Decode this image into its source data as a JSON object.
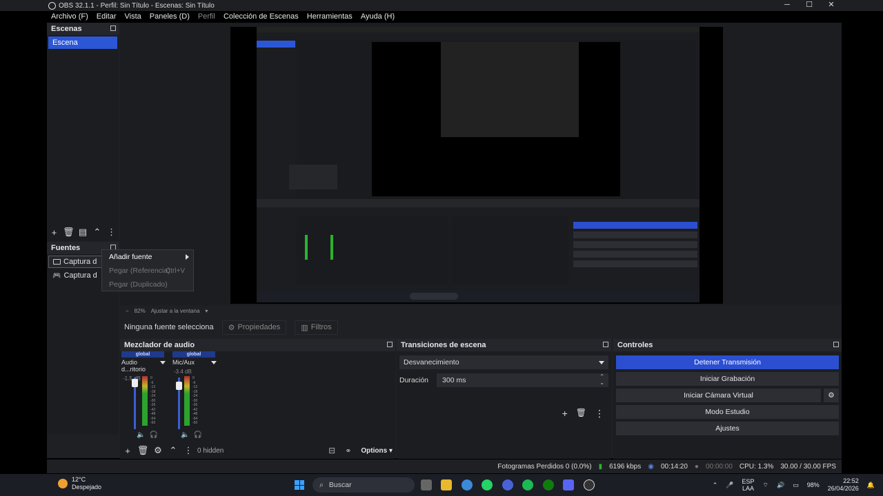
{
  "window": {
    "title": "OBS 32.1.1 - Perfil: Sin Título - Escenas: Sin Título",
    "minimize": "─",
    "maximize": "☐",
    "close": "✕"
  },
  "menu": {
    "items": [
      "Archivo (F)",
      "Editar",
      "Vista",
      "Paneles (D)",
      "Perfil",
      "Colección de Escenas",
      "Herramientas",
      "Ayuda (H)"
    ]
  },
  "scenes": {
    "title": "Escenas",
    "items": [
      "Escena"
    ]
  },
  "sources": {
    "title": "Fuentes",
    "items": [
      {
        "label": "Captura d",
        "icon": "monitor-icon"
      },
      {
        "label": "Captura d",
        "icon": "gamepad-icon"
      }
    ]
  },
  "context_menu": {
    "add_source": "Añadir fuente",
    "paste_ref": "Pegar (Referencia)",
    "paste_ref_shortcut": "Ctrl+V",
    "paste_dup": "Pegar (Duplicado)"
  },
  "zoom": {
    "minus": "−",
    "value": "82%",
    "fit": "Ajustar a la ventana"
  },
  "context_bar": {
    "no_source": "Ninguna fuente selecciona",
    "properties": "Propiedades",
    "filters": "Filtros"
  },
  "mixer": {
    "title": "Mezclador de audio",
    "strips": [
      {
        "badge": "global",
        "name": "Audio d...ritorio",
        "db": "-1.5 dB",
        "level": 0.75
      },
      {
        "badge": "global",
        "name": "Mic/Aux",
        "db": "-3.4 dB",
        "level": 0.7
      }
    ],
    "scale": [
      "0",
      "-6",
      "-12",
      "-18",
      "-24",
      "-30",
      "-36",
      "-42",
      "-48",
      "-54",
      "-60"
    ],
    "hidden": "0 hidden",
    "options": "Options"
  },
  "transitions": {
    "title": "Transiciones de escena",
    "selected": "Desvanecimiento",
    "duration_label": "Duración",
    "duration_value": "300 ms"
  },
  "controls": {
    "title": "Controles",
    "stop_stream": "Detener Transmisión",
    "start_record": "Iniciar Grabación",
    "start_vcam": "Iniciar Cámara Virtual",
    "studio_mode": "Modo Estudio",
    "settings": "Ajustes",
    "accent": "#2b4fd0"
  },
  "status": {
    "dropped": "Fotogramas Perdidos 0 (0.0%)",
    "bitrate": "6196 kbps",
    "stream_time": "00:14:20",
    "record_time": "00:00:00",
    "cpu": "CPU: 1.3%",
    "fps": "30.00 / 30.00 FPS"
  },
  "taskbar": {
    "temp": "12°C",
    "weather": "Despejado",
    "search": "Buscar",
    "lang1": "ESP",
    "lang2": "LAA",
    "battery": "98%",
    "time": "22:52",
    "date": "26/04/2026"
  }
}
